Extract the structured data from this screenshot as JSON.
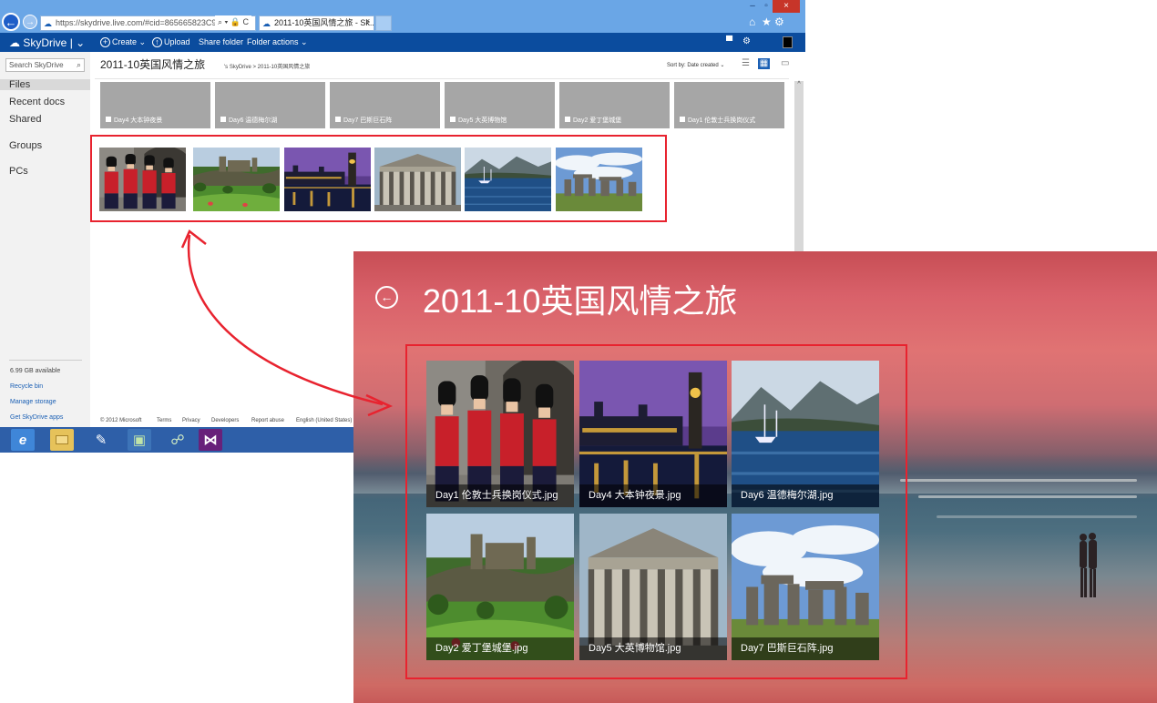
{
  "browser": {
    "address": "https://skydrive.live.com/#cid=865665823C96",
    "address_controls": "⌕ ▾ 🔒 C",
    "tab_title": "2011-10英国风情之旅 - Sk...",
    "tab_close": "×",
    "window_controls": {
      "minimize": "–",
      "maximize": "▫",
      "close": "×"
    },
    "tool_icons": [
      "home-icon",
      "star-icon",
      "gear-icon"
    ]
  },
  "appbar": {
    "brand": "SkyDrive",
    "brand_sep": "|",
    "create": "Create",
    "upload": "Upload",
    "share_folder": "Share folder",
    "folder_actions": "Folder actions"
  },
  "sidebar": {
    "search_placeholder": "Search SkyDrive",
    "items": [
      {
        "label": "Files"
      },
      {
        "label": "Recent docs"
      },
      {
        "label": "Shared"
      },
      {
        "label": "Groups"
      },
      {
        "label": "PCs"
      }
    ],
    "storage": "6.99 GB available",
    "recycle": "Recycle bin",
    "manage": "Manage storage",
    "apps": "Get SkyDrive apps"
  },
  "main": {
    "title": "2011-10英国风情之旅",
    "breadcrumb": "'s SkyDrive > 2011-10英国风情之旅",
    "sort": "Sort by: Date created ⌄",
    "folders": [
      {
        "label": "Day4 大本钟夜景"
      },
      {
        "label": "Day6 温德梅尔湖"
      },
      {
        "label": "Day7 巴斯巨石阵"
      },
      {
        "label": "Day5 大英博物馆"
      },
      {
        "label": "Day2 爱丁堡城堡"
      },
      {
        "label": "Day1 伦敦士兵换岗仪式"
      }
    ],
    "thumbs": [
      "guards",
      "castle",
      "bigben",
      "museum",
      "lake",
      "stonehenge"
    ]
  },
  "footer": [
    "© 2012 Microsoft",
    "Terms",
    "Privacy",
    "Developers",
    "Report abuse",
    "English (United States)"
  ],
  "taskbar": [
    "ie-icon",
    "explorer-icon",
    "paint-icon",
    "app-icon",
    "network-icon",
    "visual-studio-icon"
  ],
  "metro": {
    "title": "2011-10英国风情之旅",
    "photos": [
      {
        "caption": "Day1 伦敦士兵换岗仪式.jpg"
      },
      {
        "caption": "Day4 大本钟夜景.jpg"
      },
      {
        "caption": "Day6 温德梅尔湖.jpg"
      },
      {
        "caption": "Day2 爱丁堡城堡.jpg"
      },
      {
        "caption": "Day5 大英博物馆.jpg"
      },
      {
        "caption": "Day7 巴斯巨石阵.jpg"
      }
    ]
  },
  "colors": {
    "callout": "#e8232f",
    "appbar": "#0b4c9e",
    "chrome": "#6aa6e6",
    "taskbar": "#2e5fa8"
  }
}
